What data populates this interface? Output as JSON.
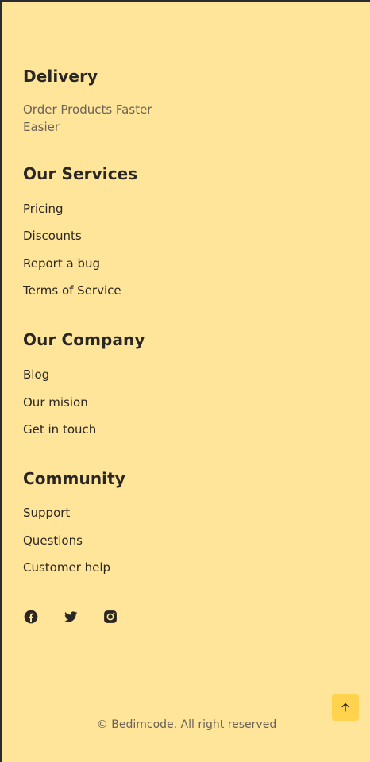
{
  "delivery": {
    "title": "Delivery",
    "description": "Order Products Faster Easier"
  },
  "services": {
    "title": "Our Services",
    "links": [
      "Pricing",
      "Discounts",
      "Report a bug",
      "Terms of Service"
    ]
  },
  "company": {
    "title": "Our Company",
    "links": [
      "Blog",
      "Our mision",
      "Get in touch"
    ]
  },
  "community": {
    "title": "Community",
    "links": [
      "Support",
      "Questions",
      "Customer help"
    ]
  },
  "social": {
    "icons": [
      "facebook-icon",
      "twitter-icon",
      "instagram-icon"
    ]
  },
  "copyright": "© Bedimcode. All right reserved",
  "colors": {
    "background": "#ffe599",
    "accent": "#ffd34d",
    "text": "#2a2623",
    "muted": "#6b6257"
  }
}
